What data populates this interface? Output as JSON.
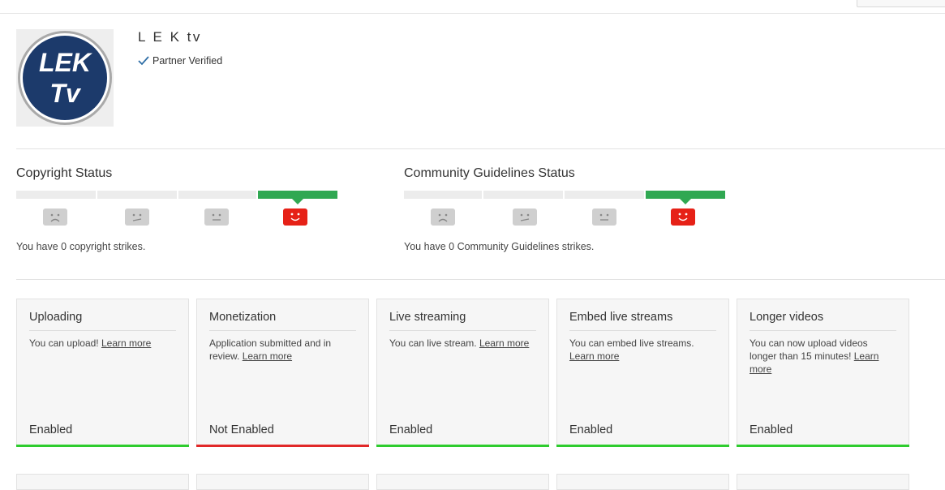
{
  "channel": {
    "name": "L E K tv",
    "verified_label": "Partner Verified",
    "logo_text_line1": "LEK",
    "logo_text_line2": "Tv"
  },
  "copyright": {
    "title": "Copyright Status",
    "strikes_text": "You have 0 copyright strikes.",
    "active_level": 4
  },
  "community": {
    "title": "Community Guidelines Status",
    "strikes_text": "You have 0 Community Guidelines strikes.",
    "active_level": 4
  },
  "features": [
    {
      "title": "Uploading",
      "desc": "You can upload! ",
      "link": "Learn more",
      "status": "Enabled"
    },
    {
      "title": "Monetization",
      "desc": "Application submitted and in review. ",
      "link": "Learn more",
      "status": "Not Enabled"
    },
    {
      "title": "Live streaming",
      "desc": "You can live stream. ",
      "link": "Learn more",
      "status": "Enabled"
    },
    {
      "title": "Embed live streams",
      "desc": "You can embed live streams. ",
      "link": "Learn more",
      "status": "Enabled"
    },
    {
      "title": "Longer videos",
      "desc": "You can now upload videos longer than 15 minutes! ",
      "link": "Learn more",
      "status": "Enabled"
    }
  ],
  "colors": {
    "active_green": "#30a852",
    "enabled_bar": "#2ecc2e",
    "not_enabled_bar": "#e12828",
    "happy_face": "#e62117",
    "logo_navy": "#1c3a6b"
  },
  "icons": [
    "checkmark-icon",
    "frown-face-icon",
    "meh-face-icon",
    "neutral-face-icon",
    "happy-face-icon"
  ]
}
